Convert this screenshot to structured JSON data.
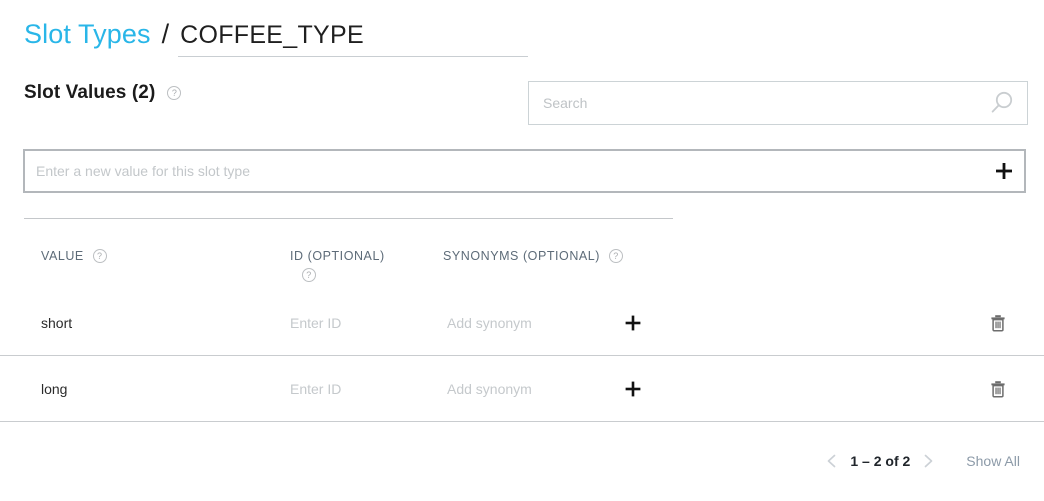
{
  "breadcrumb": {
    "parent_label": "Slot Types",
    "separator": "/",
    "slot_type_name": "COFFEE_TYPE"
  },
  "section": {
    "heading": "Slot Values (2)",
    "help_icon": "help-circle-icon",
    "help_glyph": "?"
  },
  "search": {
    "placeholder": "Search",
    "value": "",
    "icon": "search-icon"
  },
  "new_value": {
    "placeholder": "Enter a new value for this slot type",
    "value": "",
    "add_icon": "plus-icon",
    "add_glyph": "+"
  },
  "table": {
    "columns": [
      {
        "key": "value",
        "label": "VALUE",
        "help_icon": "help-circle-icon"
      },
      {
        "key": "id",
        "label": "ID (OPTIONAL)",
        "help_icon": "help-circle-icon"
      },
      {
        "key": "synonyms",
        "label": "SYNONYMS (OPTIONAL)",
        "help_icon": "help-circle-icon"
      }
    ],
    "rows": [
      {
        "value": "short",
        "id_placeholder": "Enter ID",
        "id_value": "",
        "synonym_placeholder": "Add synonym",
        "synonym_value": "",
        "add_glyph": "+",
        "add_icon": "plus-icon",
        "delete_icon": "trash-icon"
      },
      {
        "value": "long",
        "id_placeholder": "Enter ID",
        "id_value": "",
        "synonym_placeholder": "Add synonym",
        "synonym_value": "",
        "add_glyph": "+",
        "add_icon": "plus-icon",
        "delete_icon": "trash-icon"
      }
    ]
  },
  "pagination": {
    "prev_icon": "chevron-left-icon",
    "next_icon": "chevron-right-icon",
    "range_label": "1 – 2 of 2",
    "show_all_label": "Show All"
  },
  "colors": {
    "link_accent": "#29b6e8",
    "text_primary": "#1b1b1b",
    "text_muted": "#8c9aa8",
    "border": "#c9cccf",
    "placeholder": "#c3c7ca"
  }
}
